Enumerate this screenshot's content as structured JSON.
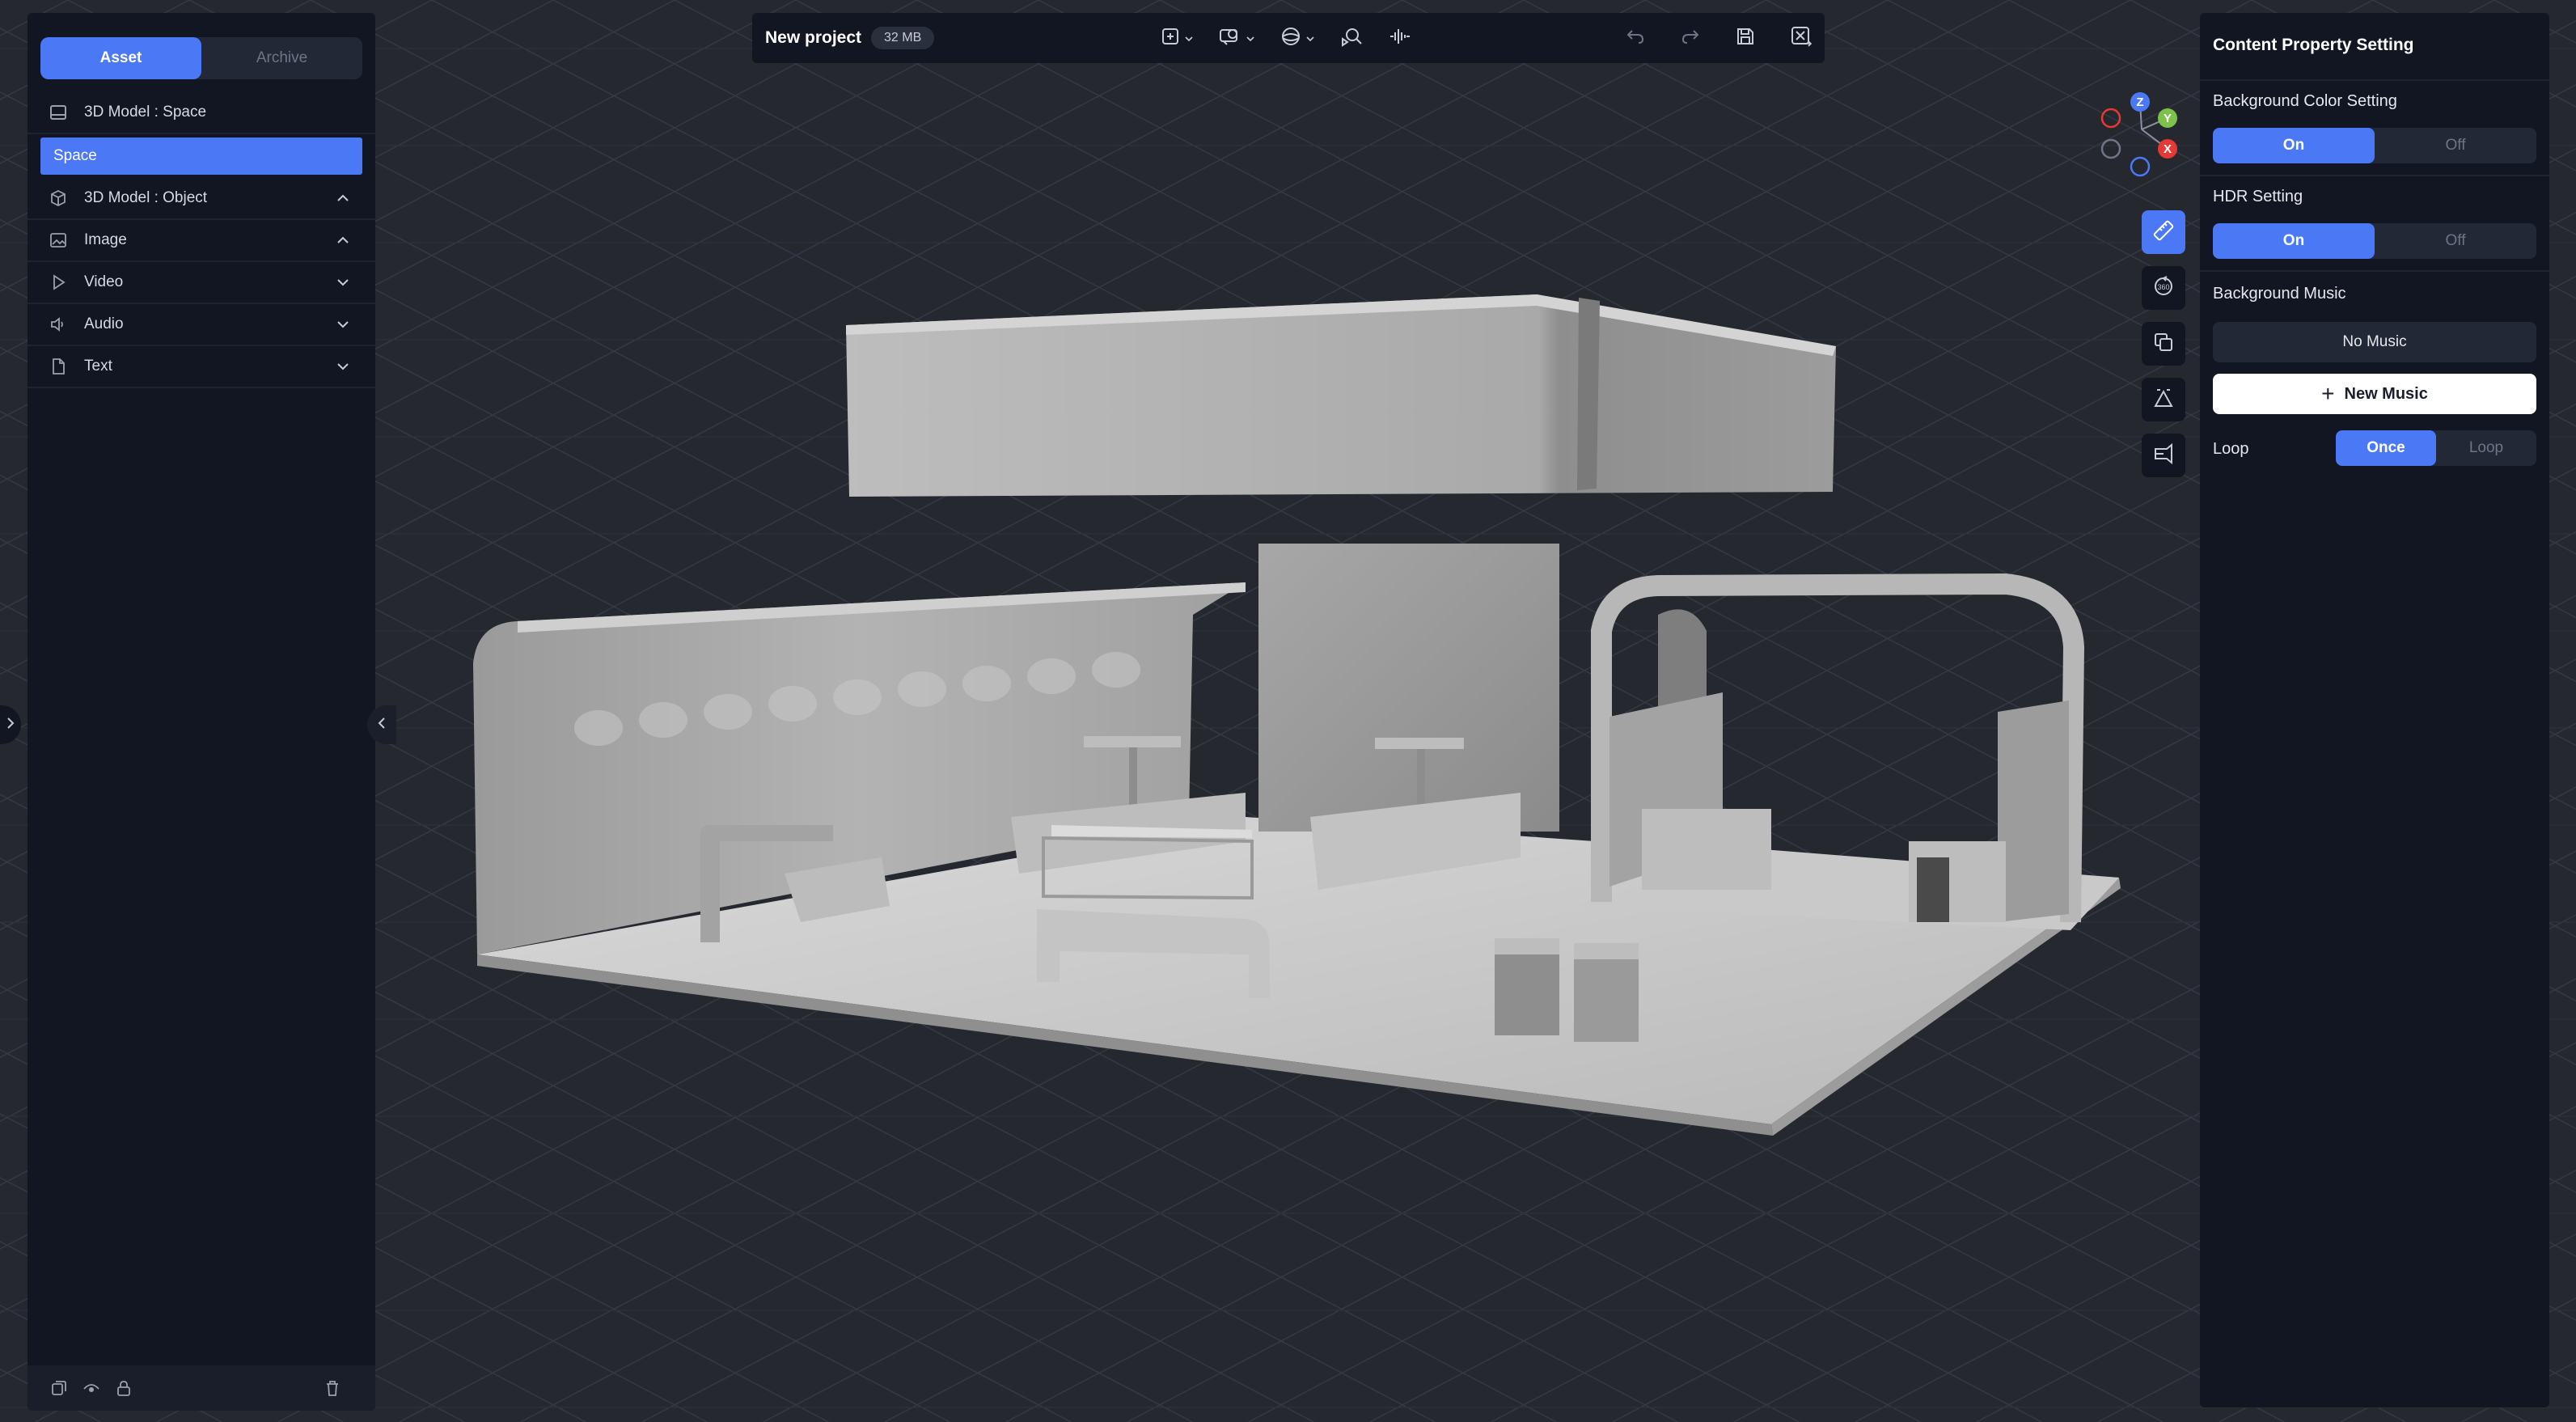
{
  "project": {
    "name": "New project",
    "size": "32 MB"
  },
  "left_panel": {
    "tabs": [
      {
        "label": "Asset",
        "active": true
      },
      {
        "label": "Archive",
        "active": false
      }
    ],
    "tree": [
      {
        "label": "3D Model : Space",
        "icon": "space-icon",
        "chevron": ""
      },
      {
        "label": "Space",
        "selected": true
      },
      {
        "label": "3D Model : Object",
        "icon": "cube-icon",
        "chevron": "up"
      },
      {
        "label": "Image",
        "icon": "image-icon",
        "chevron": "up"
      },
      {
        "label": "Video",
        "icon": "play-icon",
        "chevron": "down"
      },
      {
        "label": "Audio",
        "icon": "speaker-icon",
        "chevron": "down"
      },
      {
        "label": "Text",
        "icon": "document-icon",
        "chevron": "down"
      }
    ],
    "footer_icons": [
      "copy-icon",
      "eye-icon",
      "lock-icon",
      "trash-icon"
    ]
  },
  "top_bar": {
    "tools": [
      "add-icon",
      "camera-view-icon",
      "environment-icon",
      "inspect-icon",
      "waveform-icon"
    ],
    "actions": [
      "undo-icon",
      "redo-icon",
      "save-icon",
      "exit-icon"
    ]
  },
  "gizmo": {
    "z": "Z",
    "y": "Y",
    "x": "X",
    "colors": {
      "z": "#4b78f5",
      "y": "#7cc24a",
      "x": "#e53935"
    }
  },
  "right_tools": [
    "ruler-icon",
    "rotate-360-icon",
    "duplicate-icon",
    "scale-icon",
    "camera-icon"
  ],
  "right_panel": {
    "title": "Content Property Setting",
    "background_color": {
      "label": "Background Color Setting",
      "on": "On",
      "off": "Off"
    },
    "hdr": {
      "label": "HDR Setting",
      "on": "On",
      "off": "Off"
    },
    "music": {
      "label": "Background Music",
      "current": "No Music",
      "new_button": "New Music"
    },
    "loop": {
      "label": "Loop",
      "once": "Once",
      "loop": "Loop"
    }
  },
  "colors": {
    "accent": "#4b78f5",
    "panel": "#121622",
    "canvas": "#25282f"
  }
}
